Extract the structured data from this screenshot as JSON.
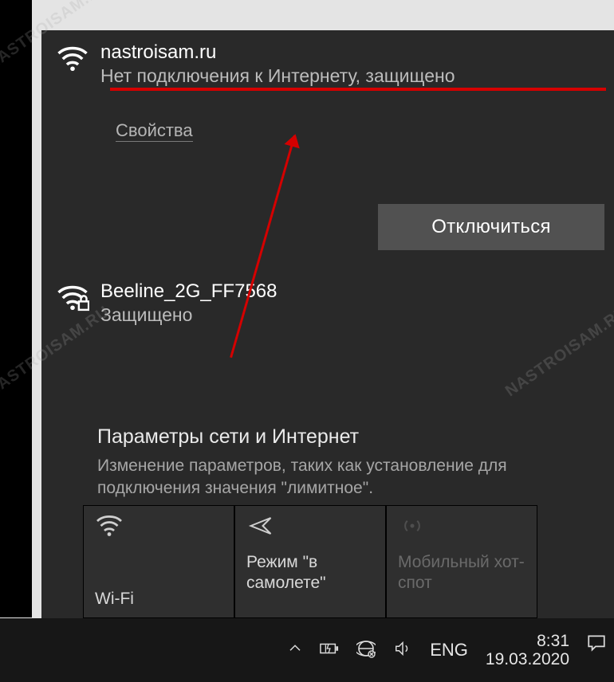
{
  "network1": {
    "ssid": "nastroisam.ru",
    "status": "Нет подключения к Интернету, защищено",
    "properties": "Свойства",
    "disconnect": "Отключиться"
  },
  "network2": {
    "ssid": "Beeline_2G_FF7568",
    "status": "Защищено"
  },
  "settings": {
    "title": "Параметры сети и Интернет",
    "desc": "Изменение параметров, таких как установление для подключения значения \"лимитное\"."
  },
  "tiles": {
    "wifi": "Wi-Fi",
    "airplane": "Режим \"в самолете\"",
    "hotspot": "Мобильный хот-спот"
  },
  "tray": {
    "lang": "ENG",
    "time": "8:31",
    "date": "19.03.2020"
  },
  "watermark": "NASTROISAM.RU"
}
